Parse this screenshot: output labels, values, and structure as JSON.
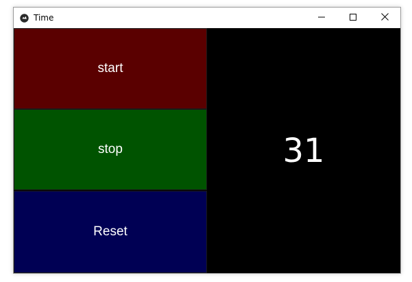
{
  "window": {
    "title": "Time"
  },
  "titlebar": {
    "icons": [
      "app-icon",
      "minimize-icon",
      "maximize-icon",
      "close-icon"
    ]
  },
  "buttons": {
    "start": {
      "label": "start",
      "color": "#5a0000"
    },
    "stop": {
      "label": "stop",
      "color": "#005300"
    },
    "reset": {
      "label": "Reset",
      "color": "#000054"
    }
  },
  "display": {
    "value": "31",
    "background": "#000000"
  }
}
